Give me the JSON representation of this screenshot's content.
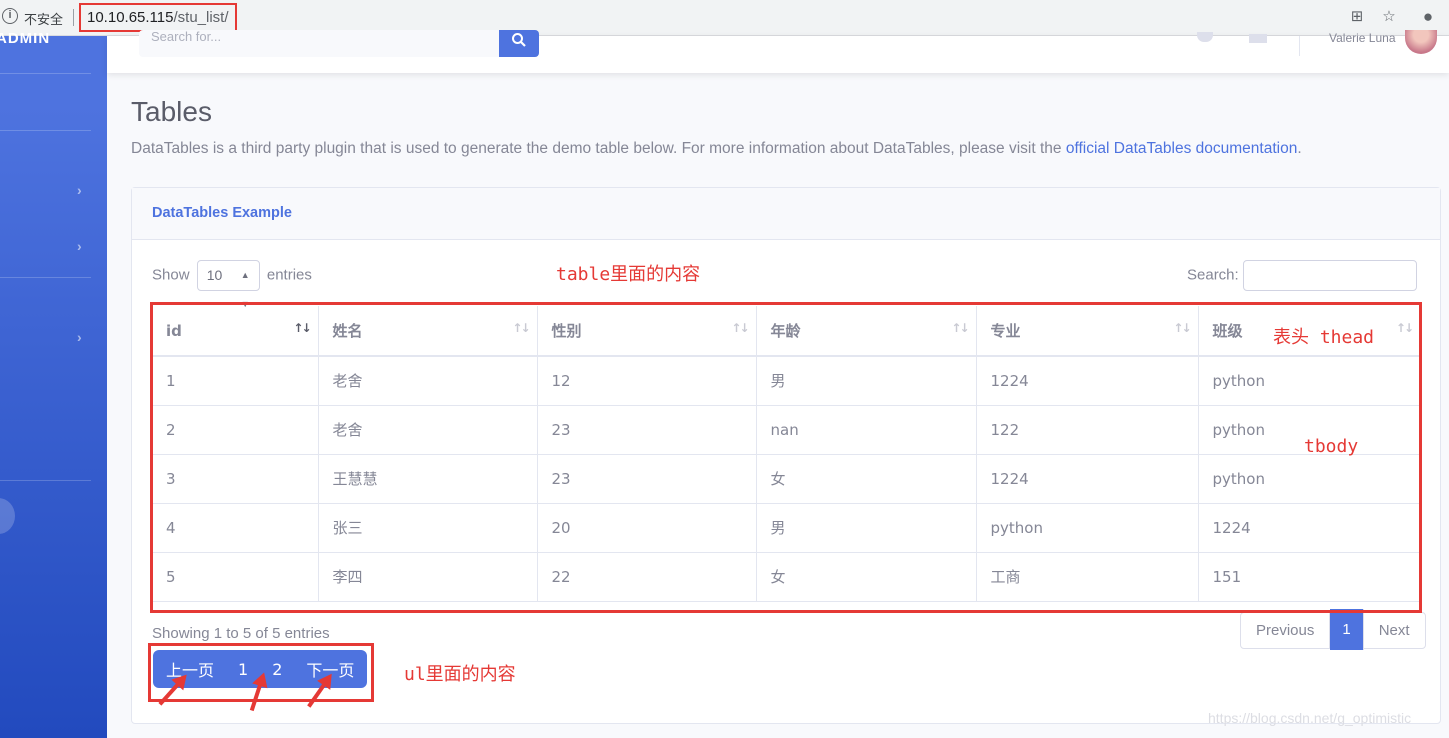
{
  "browser": {
    "insecure_label": "不安全",
    "url_host": "10.10.65.115",
    "url_path": "/stu_list/"
  },
  "sidebar": {
    "brand": "ADMIN"
  },
  "topbar": {
    "search_placeholder": "Search for...",
    "user_name": "Valerie Luna"
  },
  "page": {
    "title": "Tables",
    "description": "DataTables is a third party plugin that is used to generate the demo table below. For more information about DataTables, please visit the ",
    "description_link": "official DataTables documentation",
    "description_end": "."
  },
  "card": {
    "header": "DataTables Example",
    "show_label": "Show",
    "page_length": "10",
    "entries_label": "entries",
    "search_label": "Search:",
    "info": "Showing 1 to 5 of 5 entries",
    "pagination": {
      "previous": "Previous",
      "current": "1",
      "next": "Next"
    }
  },
  "table": {
    "columns": [
      "id",
      "姓名",
      "性别",
      "年龄",
      "专业",
      "班级"
    ],
    "rows": [
      [
        "1",
        "老舍",
        "12",
        "男",
        "1224",
        "python"
      ],
      [
        "2",
        "老舍",
        "23",
        "nan",
        "122",
        "python"
      ],
      [
        "3",
        "王慧慧",
        "23",
        "女",
        "1224",
        "python"
      ],
      [
        "4",
        "张三",
        "20",
        "男",
        "python",
        "1224"
      ],
      [
        "5",
        "李四",
        "22",
        "女",
        "工商",
        "151"
      ]
    ]
  },
  "ul_pager": [
    "上一页",
    "1",
    "2",
    "下一页"
  ],
  "annotations": {
    "table_content": "table里面的内容",
    "thead": "表头 thead",
    "tbody": "tbody",
    "ul_content": "ul里面的内容"
  },
  "watermark": "https://blog.csdn.net/g_optimistic",
  "colors": {
    "primary": "#4e73df",
    "annotation_red": "#e53935"
  }
}
